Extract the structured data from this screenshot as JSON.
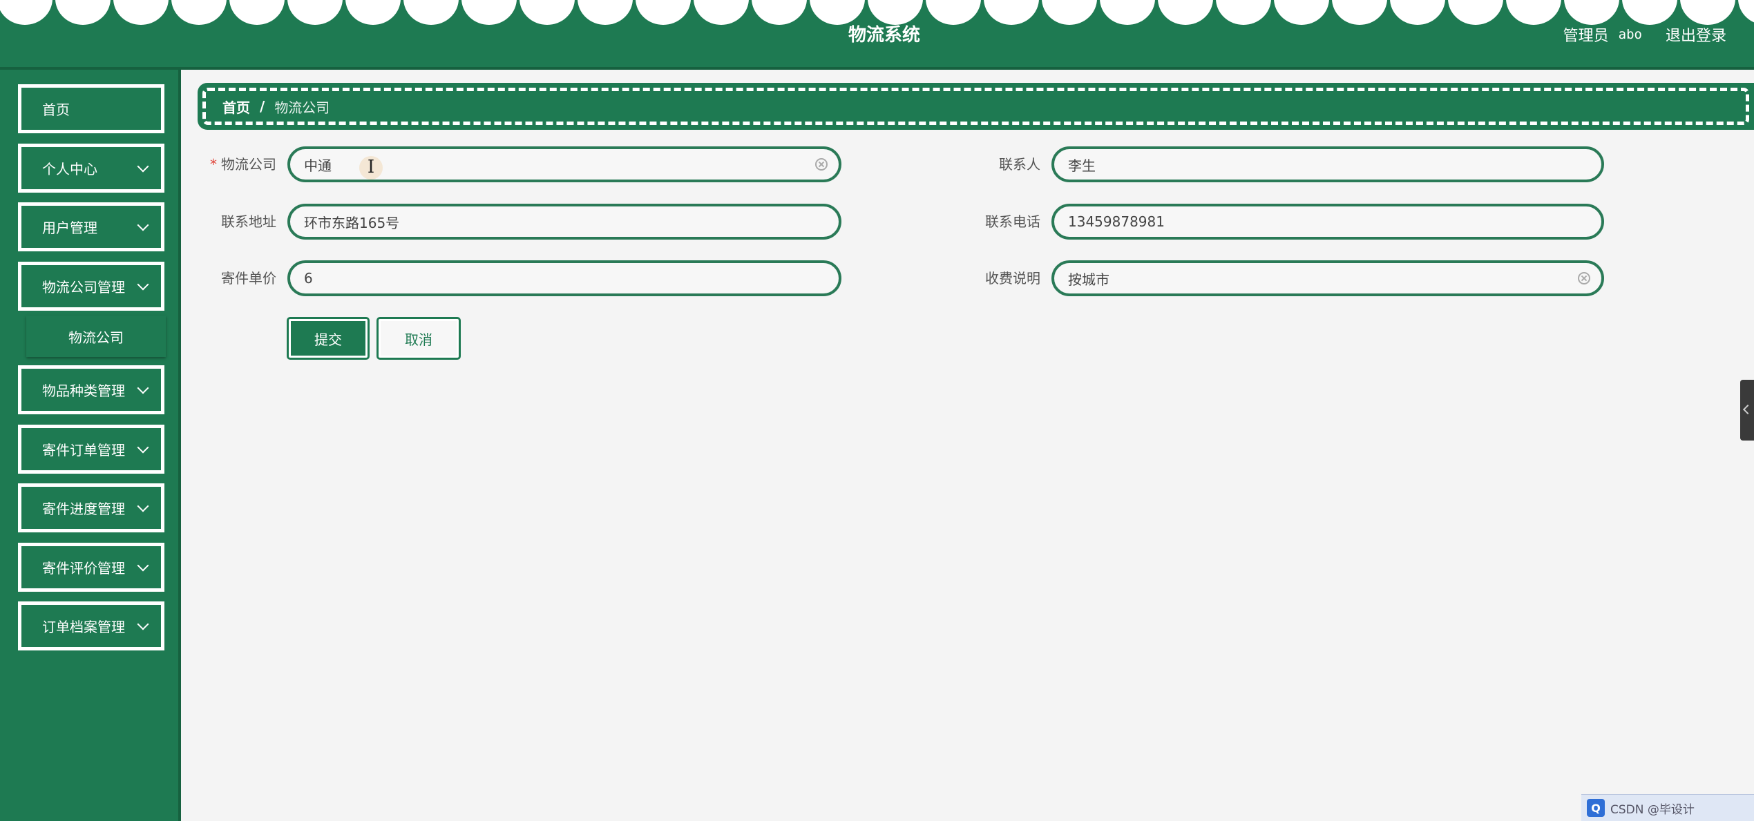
{
  "header": {
    "title": "物流系统",
    "user_label": "管理员",
    "user_name": "abo",
    "logout": "退出登录"
  },
  "sidebar": {
    "items": [
      {
        "label": "首页"
      },
      {
        "label": "个人中心"
      },
      {
        "label": "用户管理"
      },
      {
        "label": "物流公司管理"
      },
      {
        "label": "物品种类管理"
      },
      {
        "label": "寄件订单管理"
      },
      {
        "label": "寄件进度管理"
      },
      {
        "label": "寄件评价管理"
      },
      {
        "label": "订单档案管理"
      }
    ],
    "submenu": {
      "label": "物流公司"
    }
  },
  "breadcrumb": {
    "home": "首页",
    "separator": "/",
    "current": "物流公司"
  },
  "form": {
    "company": {
      "label": "物流公司",
      "required_mark": "*",
      "value": "中通"
    },
    "contact": {
      "label": "联系人",
      "value": "李生"
    },
    "address": {
      "label": "联系地址",
      "value": "环市东路165号"
    },
    "phone": {
      "label": "联系电话",
      "value": "13459878981"
    },
    "price": {
      "label": "寄件单价",
      "value": "6"
    },
    "fee_note": {
      "label": "收费说明",
      "value": "按城市"
    },
    "submit": "提交",
    "cancel": "取消"
  },
  "tray": {
    "badge": "Q",
    "text": "CSDN @毕设计"
  },
  "colors": {
    "primary": "#1e7a52",
    "background": "#f4f4f4",
    "required": "#e0463b"
  }
}
